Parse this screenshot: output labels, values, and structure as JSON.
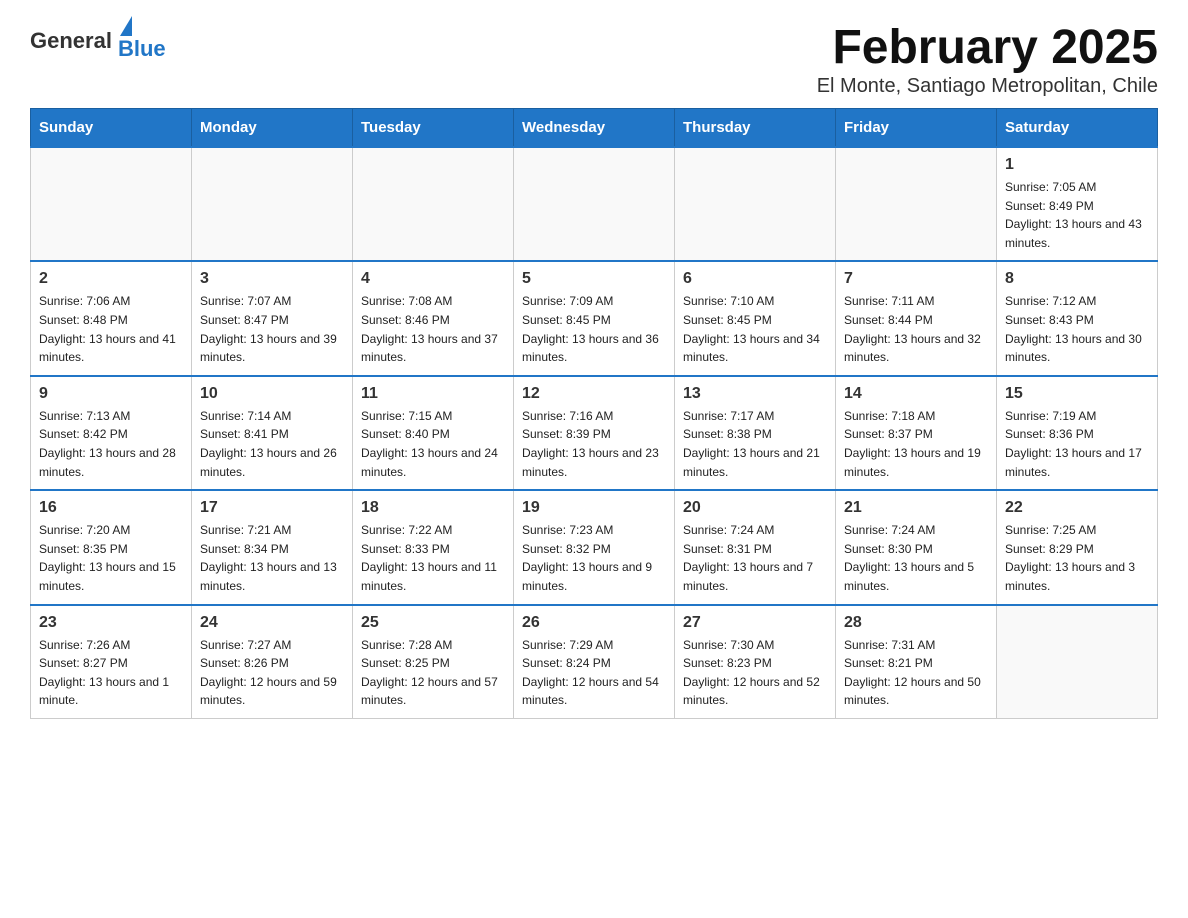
{
  "header": {
    "logo_general": "General",
    "logo_blue": "Blue",
    "title": "February 2025",
    "subtitle": "El Monte, Santiago Metropolitan, Chile"
  },
  "days_of_week": [
    "Sunday",
    "Monday",
    "Tuesday",
    "Wednesday",
    "Thursday",
    "Friday",
    "Saturday"
  ],
  "weeks": [
    [
      {
        "day": "",
        "info": ""
      },
      {
        "day": "",
        "info": ""
      },
      {
        "day": "",
        "info": ""
      },
      {
        "day": "",
        "info": ""
      },
      {
        "day": "",
        "info": ""
      },
      {
        "day": "",
        "info": ""
      },
      {
        "day": "1",
        "info": "Sunrise: 7:05 AM\nSunset: 8:49 PM\nDaylight: 13 hours and 43 minutes."
      }
    ],
    [
      {
        "day": "2",
        "info": "Sunrise: 7:06 AM\nSunset: 8:48 PM\nDaylight: 13 hours and 41 minutes."
      },
      {
        "day": "3",
        "info": "Sunrise: 7:07 AM\nSunset: 8:47 PM\nDaylight: 13 hours and 39 minutes."
      },
      {
        "day": "4",
        "info": "Sunrise: 7:08 AM\nSunset: 8:46 PM\nDaylight: 13 hours and 37 minutes."
      },
      {
        "day": "5",
        "info": "Sunrise: 7:09 AM\nSunset: 8:45 PM\nDaylight: 13 hours and 36 minutes."
      },
      {
        "day": "6",
        "info": "Sunrise: 7:10 AM\nSunset: 8:45 PM\nDaylight: 13 hours and 34 minutes."
      },
      {
        "day": "7",
        "info": "Sunrise: 7:11 AM\nSunset: 8:44 PM\nDaylight: 13 hours and 32 minutes."
      },
      {
        "day": "8",
        "info": "Sunrise: 7:12 AM\nSunset: 8:43 PM\nDaylight: 13 hours and 30 minutes."
      }
    ],
    [
      {
        "day": "9",
        "info": "Sunrise: 7:13 AM\nSunset: 8:42 PM\nDaylight: 13 hours and 28 minutes."
      },
      {
        "day": "10",
        "info": "Sunrise: 7:14 AM\nSunset: 8:41 PM\nDaylight: 13 hours and 26 minutes."
      },
      {
        "day": "11",
        "info": "Sunrise: 7:15 AM\nSunset: 8:40 PM\nDaylight: 13 hours and 24 minutes."
      },
      {
        "day": "12",
        "info": "Sunrise: 7:16 AM\nSunset: 8:39 PM\nDaylight: 13 hours and 23 minutes."
      },
      {
        "day": "13",
        "info": "Sunrise: 7:17 AM\nSunset: 8:38 PM\nDaylight: 13 hours and 21 minutes."
      },
      {
        "day": "14",
        "info": "Sunrise: 7:18 AM\nSunset: 8:37 PM\nDaylight: 13 hours and 19 minutes."
      },
      {
        "day": "15",
        "info": "Sunrise: 7:19 AM\nSunset: 8:36 PM\nDaylight: 13 hours and 17 minutes."
      }
    ],
    [
      {
        "day": "16",
        "info": "Sunrise: 7:20 AM\nSunset: 8:35 PM\nDaylight: 13 hours and 15 minutes."
      },
      {
        "day": "17",
        "info": "Sunrise: 7:21 AM\nSunset: 8:34 PM\nDaylight: 13 hours and 13 minutes."
      },
      {
        "day": "18",
        "info": "Sunrise: 7:22 AM\nSunset: 8:33 PM\nDaylight: 13 hours and 11 minutes."
      },
      {
        "day": "19",
        "info": "Sunrise: 7:23 AM\nSunset: 8:32 PM\nDaylight: 13 hours and 9 minutes."
      },
      {
        "day": "20",
        "info": "Sunrise: 7:24 AM\nSunset: 8:31 PM\nDaylight: 13 hours and 7 minutes."
      },
      {
        "day": "21",
        "info": "Sunrise: 7:24 AM\nSunset: 8:30 PM\nDaylight: 13 hours and 5 minutes."
      },
      {
        "day": "22",
        "info": "Sunrise: 7:25 AM\nSunset: 8:29 PM\nDaylight: 13 hours and 3 minutes."
      }
    ],
    [
      {
        "day": "23",
        "info": "Sunrise: 7:26 AM\nSunset: 8:27 PM\nDaylight: 13 hours and 1 minute."
      },
      {
        "day": "24",
        "info": "Sunrise: 7:27 AM\nSunset: 8:26 PM\nDaylight: 12 hours and 59 minutes."
      },
      {
        "day": "25",
        "info": "Sunrise: 7:28 AM\nSunset: 8:25 PM\nDaylight: 12 hours and 57 minutes."
      },
      {
        "day": "26",
        "info": "Sunrise: 7:29 AM\nSunset: 8:24 PM\nDaylight: 12 hours and 54 minutes."
      },
      {
        "day": "27",
        "info": "Sunrise: 7:30 AM\nSunset: 8:23 PM\nDaylight: 12 hours and 52 minutes."
      },
      {
        "day": "28",
        "info": "Sunrise: 7:31 AM\nSunset: 8:21 PM\nDaylight: 12 hours and 50 minutes."
      },
      {
        "day": "",
        "info": ""
      }
    ]
  ]
}
